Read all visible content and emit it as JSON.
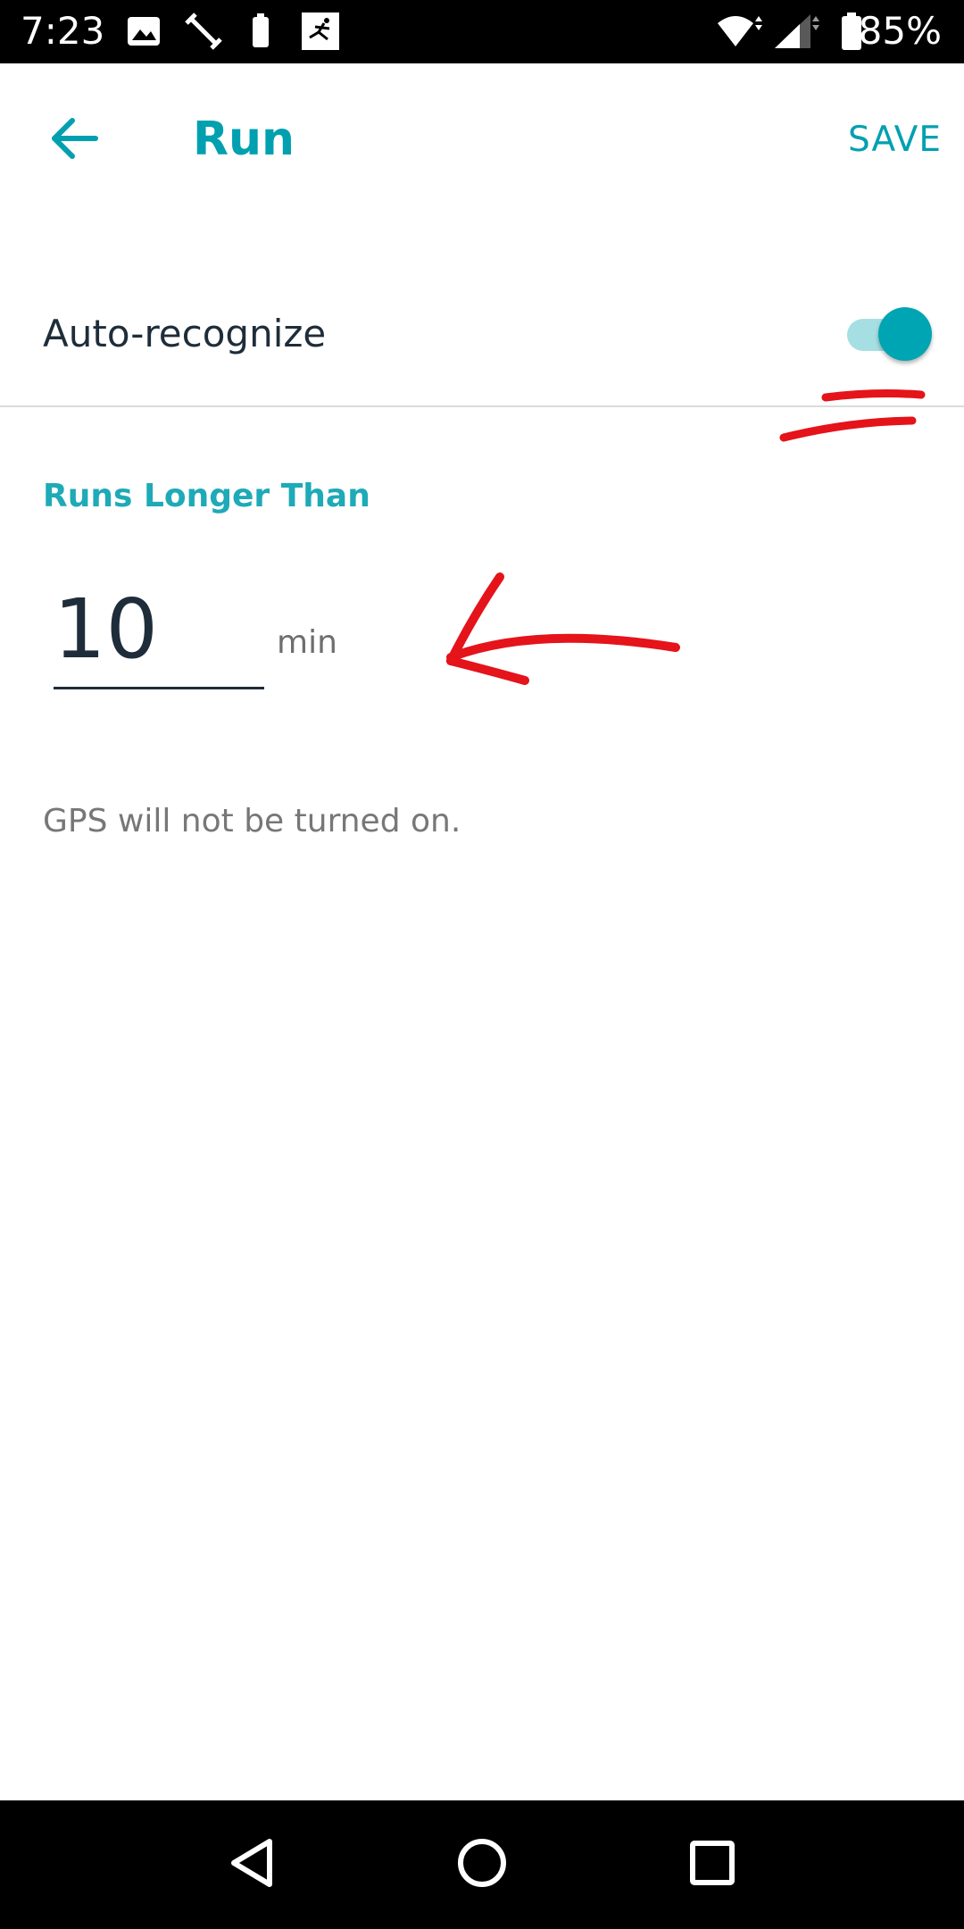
{
  "status_bar": {
    "time": "7:23",
    "battery_percent": "85%",
    "icons": [
      "image-icon",
      "workout-icon",
      "battery-small-icon",
      "fitness-app-icon",
      "wifi-icon",
      "signal-icon",
      "battery-icon"
    ]
  },
  "app_bar": {
    "back_icon": "arrow-back-icon",
    "title": "Run",
    "save_label": "SAVE"
  },
  "settings": {
    "auto_recognize_label": "Auto-recognize",
    "auto_recognize_on": true,
    "section_heading": "Runs Longer Than",
    "duration_value": "10",
    "duration_unit": "min",
    "gps_note": "GPS will not be turned on."
  },
  "nav_bar": {
    "icons": [
      "back-triangle-icon",
      "home-circle-icon",
      "recents-square-icon"
    ]
  },
  "colors": {
    "accent": "#00a0b0",
    "toggle_track": "#a6dfe3",
    "toggle_thumb": "#00a5b3",
    "annotation": "#e5131a",
    "text_primary": "#1f2d3a",
    "text_secondary": "#777777"
  }
}
